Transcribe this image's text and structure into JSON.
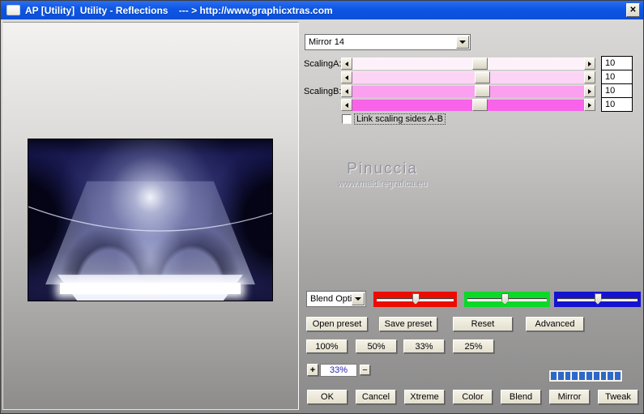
{
  "window": {
    "title": "AP [Utility]  Utility - Reflections    --- > http://www.graphicxtras.com"
  },
  "icons": {
    "close": "✕"
  },
  "preset_dropdown": {
    "value": "Mirror 14"
  },
  "scaling": {
    "label_a": "ScalingA:",
    "label_b": "ScalingB:",
    "link_label": "Link scaling sides A-B",
    "link_checked": false,
    "rows": [
      {
        "value": "10",
        "track_color": "#fdf2fa",
        "thumb_percent": 55
      },
      {
        "value": "10",
        "track_color": "#fcd4f5",
        "thumb_percent": 56
      },
      {
        "value": "10",
        "track_color": "#faa0ef",
        "thumb_percent": 56
      },
      {
        "value": "10",
        "track_color": "#f863e9",
        "thumb_percent": 55
      }
    ]
  },
  "watermark": {
    "title": "Pinuccia",
    "subtitle": "www.maidiregrafica.eu"
  },
  "blend_dropdown": {
    "value": "Blend Opti"
  },
  "channels": [
    {
      "name": "red",
      "color": "#ed0c00",
      "thumb_percent": 50
    },
    {
      "name": "green",
      "color": "#0cd828",
      "thumb_percent": 47
    },
    {
      "name": "blue",
      "color": "#1513cf",
      "thumb_percent": 50
    }
  ],
  "preset_buttons": {
    "open": "Open preset",
    "save": "Save preset",
    "reset": "Reset",
    "advanced": "Advanced"
  },
  "zoom_buttons": {
    "b100": "100%",
    "b50": "50%",
    "b33": "33%",
    "b25": "25%"
  },
  "zoom_control": {
    "plus": "+",
    "value": "33%",
    "minus": "−"
  },
  "progress": {
    "segments": 10,
    "color": "#2e68c8"
  },
  "action_buttons": {
    "ok": "OK",
    "cancel": "Cancel",
    "xtreme": "Xtreme",
    "color": "Color",
    "blend": "Blend",
    "mirror": "Mirror",
    "tweak": "Tweak"
  }
}
